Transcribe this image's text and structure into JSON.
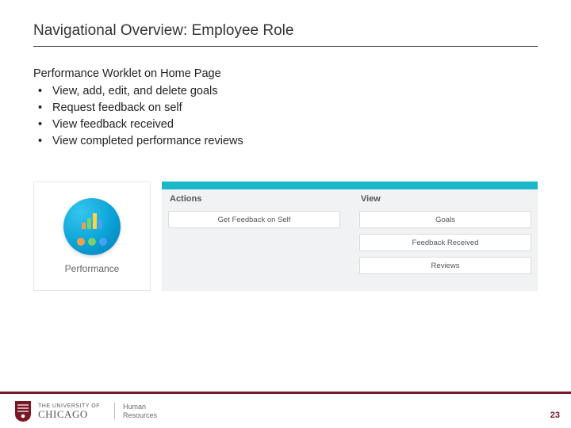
{
  "title": "Navigational Overview: Employee Role",
  "section_heading": "Performance Worklet on Home Page",
  "bullets": [
    "View, add, edit, and delete goals",
    "Request feedback on self",
    "View feedback received",
    "View completed performance reviews"
  ],
  "worklet": {
    "label": "Performance"
  },
  "panels": {
    "actions": {
      "title": "Actions",
      "items": [
        "Get Feedback on Self"
      ]
    },
    "view": {
      "title": "View",
      "items": [
        "Goals",
        "Feedback Received",
        "Reviews"
      ]
    }
  },
  "footer": {
    "univ_small": "THE UNIVERSITY OF",
    "univ_name": "CHICAGO",
    "dept_line1": "Human",
    "dept_line2": "Resources"
  },
  "page_number": "23",
  "colors": {
    "accent": "#7a1626",
    "teal": "#1bb8c9"
  }
}
